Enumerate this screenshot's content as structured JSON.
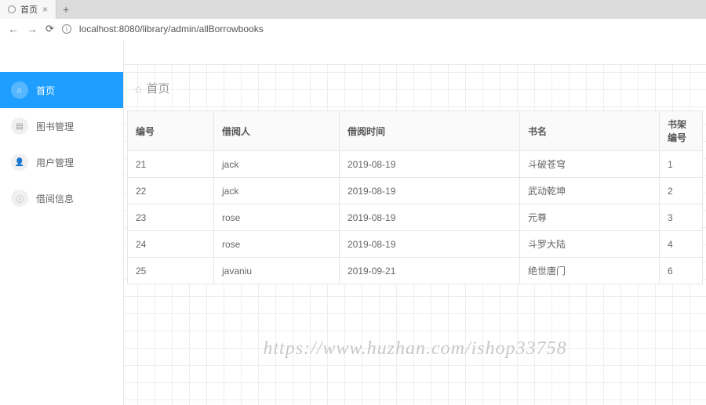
{
  "browser": {
    "tab_title": "首页",
    "url": "localhost:8080/library/admin/allBorrowbooks"
  },
  "sidebar": {
    "items": [
      {
        "label": "首页",
        "icon": "home",
        "active": true
      },
      {
        "label": "图书管理",
        "icon": "book",
        "active": false
      },
      {
        "label": "用户管理",
        "icon": "user",
        "active": false
      },
      {
        "label": "借阅信息",
        "icon": "info",
        "active": false
      }
    ]
  },
  "page": {
    "title": "首页"
  },
  "table": {
    "headers": [
      "编号",
      "借阅人",
      "借阅时间",
      "书名",
      "书架编号"
    ],
    "rows": [
      {
        "c0": "21",
        "c1": "jack",
        "c2": "2019-08-19",
        "c3": "斗破苍穹",
        "c4": "1"
      },
      {
        "c0": "22",
        "c1": "jack",
        "c2": "2019-08-19",
        "c3": "武动乾坤",
        "c4": "2"
      },
      {
        "c0": "23",
        "c1": "rose",
        "c2": "2019-08-19",
        "c3": "元尊",
        "c4": "3"
      },
      {
        "c0": "24",
        "c1": "rose",
        "c2": "2019-08-19",
        "c3": "斗罗大陆",
        "c4": "4"
      },
      {
        "c0": "25",
        "c1": "javaniu",
        "c2": "2019-09-21",
        "c3": "绝世唐门",
        "c4": "6"
      }
    ]
  },
  "watermark": "https://www.huzhan.com/ishop33758"
}
